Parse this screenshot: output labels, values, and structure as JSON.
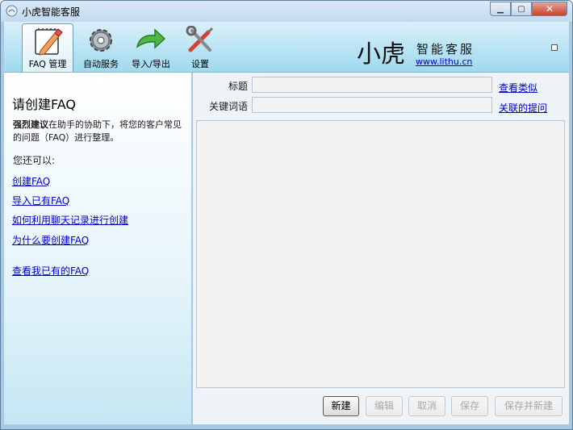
{
  "window": {
    "title": "小虎智能客服"
  },
  "toolbar": {
    "items": [
      {
        "label": "FAQ 管理",
        "icon": "faq-notebook-icon"
      },
      {
        "label": "自动服务",
        "icon": "gear-icon"
      },
      {
        "label": "导入/导出",
        "icon": "green-arrow-icon"
      },
      {
        "label": "设置",
        "icon": "tools-icon"
      }
    ],
    "brand_name": "小虎",
    "brand_sub": "智能客服",
    "brand_url": "www.lithu.cn"
  },
  "left": {
    "title": "请创建FAQ",
    "desc_bold": "强烈建议",
    "desc_rest": "在助手的协助下，将您的客户常见的问题（FAQ）进行整理。",
    "also": "您还可以:",
    "links": [
      "创建FAQ",
      "导入已有FAQ",
      "如何利用聊天记录进行创建",
      "为什么要创建FAQ"
    ],
    "my_faq_link": "查看我已有的FAQ"
  },
  "form": {
    "title_label": "标题",
    "title_value": "",
    "keywords_label": "关键词语",
    "keywords_value": "",
    "view_similar": "查看类似",
    "related_questions": "关联的提问",
    "content_value": ""
  },
  "buttons": {
    "new": "新建",
    "edit": "编辑",
    "cancel": "取消",
    "save": "保存",
    "save_new": "保存并新建"
  }
}
